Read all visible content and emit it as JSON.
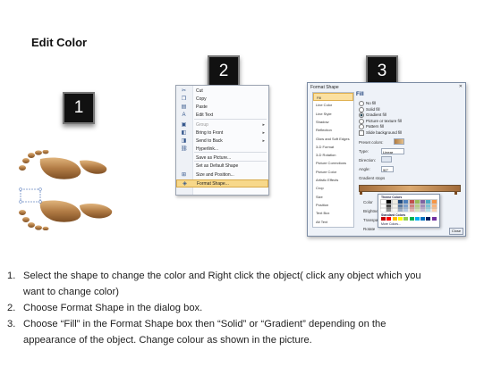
{
  "title": "Edit Color",
  "step_numbers": [
    "1",
    "2",
    "3"
  ],
  "context_menu": {
    "items": [
      {
        "label": "Cut",
        "icon": "scissors-icon",
        "glyph": "✂",
        "arrow": "",
        "disabled": false,
        "highlighted": false
      },
      {
        "label": "Copy",
        "icon": "copy-icon",
        "glyph": "❐",
        "arrow": "",
        "disabled": false,
        "highlighted": false
      },
      {
        "label": "Paste",
        "icon": "paste-icon",
        "glyph": "▤",
        "arrow": "",
        "disabled": false,
        "highlighted": false
      },
      {
        "label": "Edit Text",
        "icon": "text-icon",
        "glyph": "A",
        "arrow": "",
        "disabled": false,
        "highlighted": false
      },
      {
        "label": "Group",
        "icon": "group-icon",
        "glyph": "▣",
        "arrow": "▸",
        "disabled": true,
        "highlighted": false
      },
      {
        "label": "Bring to Front",
        "icon": "bring-front-icon",
        "glyph": "◧",
        "arrow": "▸",
        "disabled": false,
        "highlighted": false
      },
      {
        "label": "Send to Back",
        "icon": "send-back-icon",
        "glyph": "◨",
        "arrow": "▸",
        "disabled": false,
        "highlighted": false
      },
      {
        "label": "Hyperlink...",
        "icon": "hyperlink-icon",
        "glyph": "⛓",
        "arrow": "",
        "disabled": false,
        "highlighted": false
      },
      {
        "label": "Save as Picture...",
        "icon": "",
        "glyph": "",
        "arrow": "",
        "disabled": false,
        "highlighted": false
      },
      {
        "label": "Set as Default Shape",
        "icon": "",
        "glyph": "",
        "arrow": "",
        "disabled": false,
        "highlighted": false
      },
      {
        "label": "Size and Position...",
        "icon": "size-position-icon",
        "glyph": "⊞",
        "arrow": "",
        "disabled": false,
        "highlighted": false
      },
      {
        "label": "Format Shape...",
        "icon": "format-shape-icon",
        "glyph": "◈",
        "arrow": "",
        "disabled": false,
        "highlighted": true
      }
    ]
  },
  "dialog": {
    "title": "Format Shape",
    "close_glyph": "✕",
    "categories": [
      "Fill",
      "Line Color",
      "Line Style",
      "Shadow",
      "Reflection",
      "Glow and Soft Edges",
      "3-D Format",
      "3-D Rotation",
      "Picture Corrections",
      "Picture Color",
      "Artistic Effects",
      "Crop",
      "Size",
      "Position",
      "Text Box",
      "Alt Text"
    ],
    "selected_category": "Fill",
    "pane_title": "Fill",
    "fill_options": [
      {
        "label": "No fill",
        "type": "radio",
        "checked": false
      },
      {
        "label": "Solid fill",
        "type": "radio",
        "checked": false
      },
      {
        "label": "Gradient fill",
        "type": "radio",
        "checked": true
      },
      {
        "label": "Picture or texture fill",
        "type": "radio",
        "checked": false
      },
      {
        "label": "Pattern fill",
        "type": "radio",
        "checked": false
      },
      {
        "label": "Slide background fill",
        "type": "checkbox",
        "checked": false
      }
    ],
    "preset_colors_label": "Preset colors:",
    "type_label": "Type:",
    "type_value": "Linear",
    "direction_label": "Direction:",
    "angle_label": "Angle:",
    "angle_value": "90°",
    "gradient_stops_label": "Gradient stops",
    "color_label": "Color",
    "position_label": "Position:",
    "position_value": "100%",
    "brightness_label": "Brightness",
    "transparency_label": "Transparency",
    "rotate_label": "Rotate",
    "theme_colors_label": "Theme Colors",
    "standard_colors_label": "Standard Colors",
    "more_colors_label": "More Colors...",
    "close_button": "Close",
    "theme_colors": [
      "#ffffff",
      "#000000",
      "#eeece1",
      "#1f497d",
      "#4f81bd",
      "#c0504d",
      "#9bbb59",
      "#8064a2",
      "#4bacc6",
      "#f79646"
    ],
    "standard_colors": [
      "#c00000",
      "#ff0000",
      "#ffc000",
      "#ffff00",
      "#92d050",
      "#00b050",
      "#00b0f0",
      "#0070c0",
      "#002060",
      "#7030a0"
    ]
  },
  "instructions": [
    {
      "num": "1.",
      "text": "Select the shape to change the color and Right click the object( click any object which you"
    },
    {
      "num": "",
      "text": "want to change color)"
    },
    {
      "num": "2.",
      "text": "Choose Format Shape in the dialog box."
    },
    {
      "num": "3.",
      "text": "Choose “Fill” in the Format Shape box then “Solid” or “Gradient” depending on the"
    },
    {
      "num": "",
      "text": "appearance of the object. Change colour as shown in the picture."
    }
  ],
  "colors": {
    "foot_light": "#d9ad76",
    "foot_dark": "#8f5d2e",
    "highlight": "#f7d88a",
    "accent": "#1a3d78"
  }
}
